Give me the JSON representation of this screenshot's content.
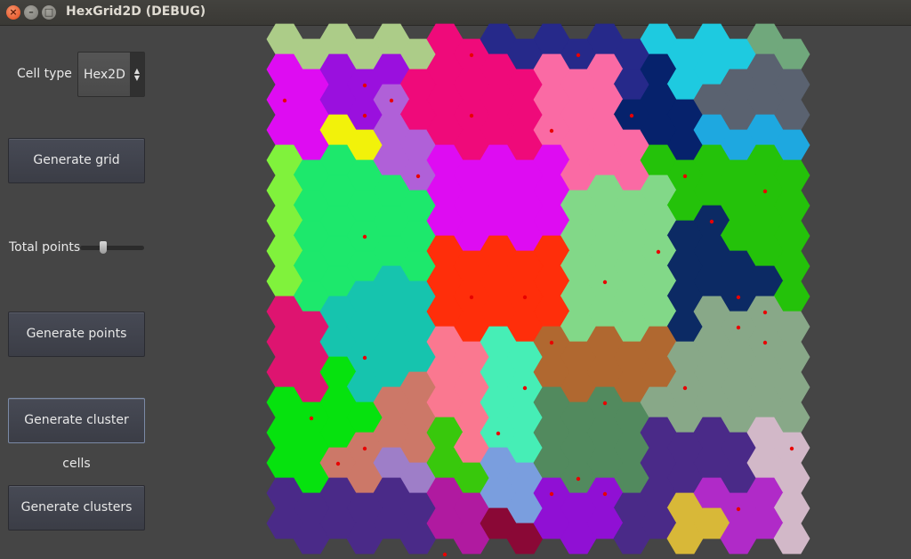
{
  "window": {
    "title": "HexGrid2D (DEBUG)",
    "close_glyph": "×",
    "minimize_glyph": "–",
    "maximize_glyph": "□"
  },
  "sidebar": {
    "cell_type_label": "Cell type",
    "cell_type_value": "Hex2D",
    "generate_grid": "Generate grid",
    "total_points_label": "Total points",
    "total_points_slider_fraction": 0.35,
    "generate_points": "Generate points",
    "generate_cluster_cells": "Generate cluster cells",
    "generate_clusters": "Generate clusters"
  },
  "hexgrid": {
    "columns": 20,
    "rows": 17,
    "colors": [
      [
        "#accc88",
        "#accc88",
        "#accc88",
        "#accc88",
        "#accc88",
        "#accc88",
        "#ef0a7a",
        "#ef0a7a",
        "#26298a",
        "#26298a",
        "#26298a",
        "#26298a",
        "#26298a",
        "#26298a",
        "#1ecae0",
        "#1ecae0",
        "#1ecae0",
        "#1ecae0",
        "#70a87c",
        "#70a87c"
      ],
      [
        "#de0cf2",
        "#de0cf2",
        "#9a10de",
        "#9a10de",
        "#9a10de",
        "#ef0a7a",
        "#ef0a7a",
        "#ef0a7a",
        "#ef0a7a",
        "#ef0a7a",
        "#fa6aa4",
        "#fa6aa4",
        "#fa6aa4",
        "#26298a",
        "#06226c",
        "#1ecae0",
        "#1ecae0",
        "#5a6270",
        "#5a6270",
        "#5a6270"
      ],
      [
        "#de0cf2",
        "#de0cf2",
        "#9a10de",
        "#9a10de",
        "#b060d8",
        "#ef0a7a",
        "#ef0a7a",
        "#ef0a7a",
        "#ef0a7a",
        "#ef0a7a",
        "#fa6aa4",
        "#fa6aa4",
        "#fa6aa4",
        "#06226c",
        "#06226c",
        "#06226c",
        "#5a6270",
        "#5a6270",
        "#5a6270",
        "#5a6270"
      ],
      [
        "#de0cf2",
        "#de0cf2",
        "#f2f20a",
        "#f2f20a",
        "#b060d8",
        "#b060d8",
        "#ef0a7a",
        "#ef0a7a",
        "#ef0a7a",
        "#ef0a7a",
        "#fa6aa4",
        "#fa6aa4",
        "#fa6aa4",
        "#fa6aa4",
        "#06226c",
        "#06226c",
        "#1ea8e0",
        "#1ea8e0",
        "#1ea8e0",
        "#1ea8e0"
      ],
      [
        "#80f23c",
        "#1de86c",
        "#1de86c",
        "#1de86c",
        "#b060d8",
        "#b060d8",
        "#de0cf2",
        "#de0cf2",
        "#de0cf2",
        "#de0cf2",
        "#de0cf2",
        "#fa6aa4",
        "#fa6aa4",
        "#fa6aa4",
        "#24c20a",
        "#24c20a",
        "#24c20a",
        "#24c20a",
        "#24c20a",
        "#24c20a"
      ],
      [
        "#80f23c",
        "#1de86c",
        "#1de86c",
        "#1de86c",
        "#1de86c",
        "#1de86c",
        "#de0cf2",
        "#de0cf2",
        "#de0cf2",
        "#de0cf2",
        "#de0cf2",
        "#82d888",
        "#82d888",
        "#82d888",
        "#82d888",
        "#24c20a",
        "#24c20a",
        "#24c20a",
        "#24c20a",
        "#24c20a"
      ],
      [
        "#80f23c",
        "#1de86c",
        "#1de86c",
        "#1de86c",
        "#1de86c",
        "#1de86c",
        "#de0cf2",
        "#de0cf2",
        "#de0cf2",
        "#de0cf2",
        "#de0cf2",
        "#82d888",
        "#82d888",
        "#82d888",
        "#82d888",
        "#0c2a64",
        "#0c2a64",
        "#24c20a",
        "#24c20a",
        "#24c20a"
      ],
      [
        "#80f23c",
        "#1de86c",
        "#1de86c",
        "#1de86c",
        "#1de86c",
        "#1de86c",
        "#ff2e0a",
        "#ff2e0a",
        "#ff2e0a",
        "#ff2e0a",
        "#ff2e0a",
        "#82d888",
        "#82d888",
        "#82d888",
        "#82d888",
        "#0c2a64",
        "#0c2a64",
        "#0c2a64",
        "#24c20a",
        "#24c20a"
      ],
      [
        "#80f23c",
        "#1de86c",
        "#1de86c",
        "#16c4ae",
        "#16c4ae",
        "#16c4ae",
        "#ff2e0a",
        "#ff2e0a",
        "#ff2e0a",
        "#ff2e0a",
        "#ff2e0a",
        "#82d888",
        "#82d888",
        "#82d888",
        "#82d888",
        "#0c2a64",
        "#0c2a64",
        "#0c2a64",
        "#0c2a64",
        "#24c20a"
      ],
      [
        "#de1470",
        "#de1470",
        "#16c4ae",
        "#16c4ae",
        "#16c4ae",
        "#16c4ae",
        "#ff2e0a",
        "#ff2e0a",
        "#ff2e0a",
        "#ff2e0a",
        "#ff2e0a",
        "#82d888",
        "#82d888",
        "#82d888",
        "#82d888",
        "#0c2a64",
        "#88a888",
        "#88a888",
        "#88a888",
        "#88a888"
      ],
      [
        "#de1470",
        "#de1470",
        "#16c4ae",
        "#16c4ae",
        "#16c4ae",
        "#16c4ae",
        "#fa7890",
        "#fa7890",
        "#46eeb6",
        "#46eeb6",
        "#b06830",
        "#b06830",
        "#b06830",
        "#b06830",
        "#b06830",
        "#88a888",
        "#88a888",
        "#88a888",
        "#88a888",
        "#88a888"
      ],
      [
        "#de1470",
        "#de1470",
        "#06e20e",
        "#16c4ae",
        "#16c4ae",
        "#cc7868",
        "#fa7890",
        "#fa7890",
        "#46eeb6",
        "#46eeb6",
        "#b06830",
        "#b06830",
        "#b06830",
        "#b06830",
        "#b06830",
        "#88a888",
        "#88a888",
        "#88a888",
        "#88a888",
        "#88a888"
      ],
      [
        "#06e20e",
        "#06e20e",
        "#06e20e",
        "#06e20e",
        "#cc7868",
        "#cc7868",
        "#fa7890",
        "#fa7890",
        "#46eeb6",
        "#46eeb6",
        "#528a5e",
        "#528a5e",
        "#528a5e",
        "#528a5e",
        "#88a888",
        "#88a888",
        "#88a888",
        "#88a888",
        "#88a888",
        "#88a888"
      ],
      [
        "#06e20e",
        "#06e20e",
        "#06e20e",
        "#cc7868",
        "#cc7868",
        "#cc7868",
        "#38c80c",
        "#fa7890",
        "#46eeb6",
        "#46eeb6",
        "#528a5e",
        "#528a5e",
        "#528a5e",
        "#528a5e",
        "#4a2a88",
        "#4a2a88",
        "#4a2a88",
        "#4a2a88",
        "#d2b8c8",
        "#d2b8c8"
      ],
      [
        "#06e20e",
        "#06e20e",
        "#cc7868",
        "#cc7868",
        "#9e7ec8",
        "#9e7ec8",
        "#38c80c",
        "#38c80c",
        "#7a9ede",
        "#7a9ede",
        "#528a5e",
        "#528a5e",
        "#528a5e",
        "#528a5e",
        "#4a2a88",
        "#4a2a88",
        "#4a2a88",
        "#4a2a88",
        "#d2b8c8",
        "#d2b8c8"
      ],
      [
        "#4a2a88",
        "#4a2a88",
        "#4a2a88",
        "#4a2a88",
        "#4a2a88",
        "#4a2a88",
        "#b01aa0",
        "#b01aa0",
        "#7a9ede",
        "#7a9ede",
        "#9010d4",
        "#9010d4",
        "#9010d4",
        "#4a2a88",
        "#4a2a88",
        "#d8b838",
        "#b02ac8",
        "#b02ac8",
        "#b02ac8",
        "#d2b8c8"
      ],
      [
        "#4a2a88",
        "#4a2a88",
        "#4a2a88",
        "#4a2a88",
        "#4a2a88",
        "#4a2a88",
        "#b01aa0",
        "#b01aa0",
        "#8a0836",
        "#8a0836",
        "#9010d4",
        "#9010d4",
        "#9010d4",
        "#4a2a88",
        "#4a2a88",
        "#d8b838",
        "#d8b838",
        "#b02ac8",
        "#b02ac8",
        "#d2b8c8"
      ]
    ],
    "points": [
      [
        2,
        0
      ],
      [
        12,
        1
      ],
      [
        14,
        2
      ],
      [
        18,
        0
      ],
      [
        1,
        3
      ],
      [
        2,
        3
      ],
      [
        6,
        3
      ],
      [
        10,
        3
      ],
      [
        13,
        3
      ],
      [
        17,
        3
      ],
      [
        2,
        4
      ],
      [
        4,
        5
      ],
      [
        17,
        6
      ],
      [
        0,
        7
      ],
      [
        2,
        7
      ],
      [
        8,
        7
      ],
      [
        10,
        10
      ],
      [
        13,
        8
      ],
      [
        15,
        10
      ],
      [
        8,
        9
      ],
      [
        11,
        9
      ],
      [
        14,
        11
      ],
      [
        0,
        11
      ],
      [
        3,
        10
      ],
      [
        8,
        12
      ],
      [
        12,
        12
      ],
      [
        15,
        12
      ],
      [
        2,
        13
      ],
      [
        7,
        14
      ],
      [
        4,
        15
      ],
      [
        11,
        15
      ],
      [
        6,
        16
      ],
      [
        9,
        17
      ],
      [
        15,
        17
      ],
      [
        5,
        18
      ],
      [
        13,
        19
      ],
      [
        8,
        17
      ],
      [
        9,
        18
      ],
      [
        10,
        18
      ],
      [
        17,
        17
      ],
      [
        17,
        19
      ]
    ]
  }
}
